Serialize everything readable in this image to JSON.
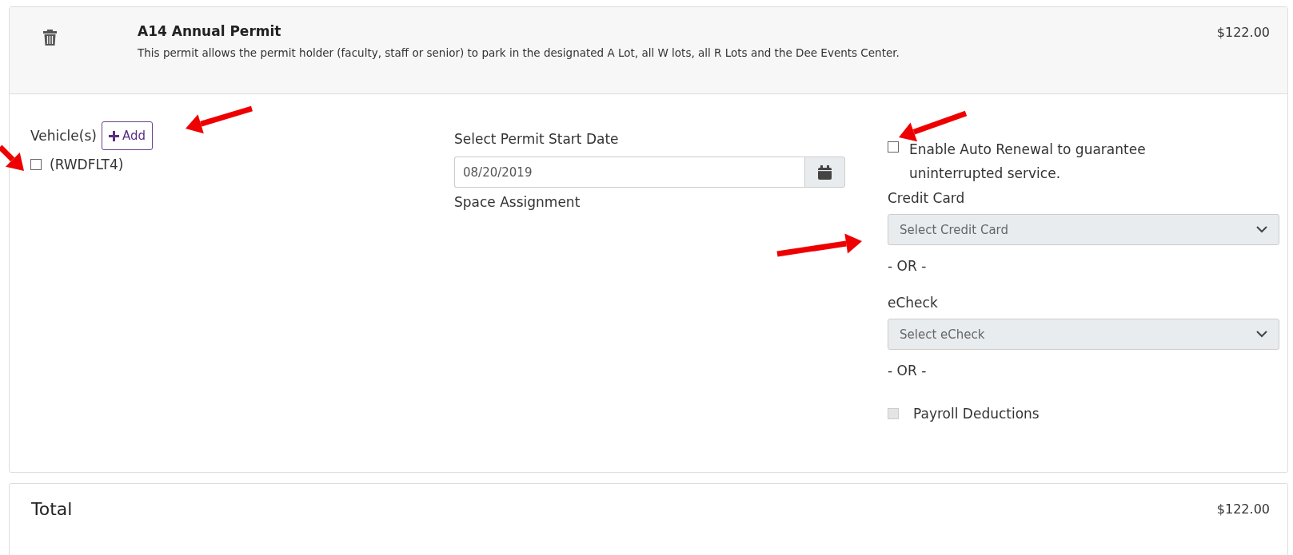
{
  "permit": {
    "title": "A14 Annual Permit",
    "description": "This permit allows the permit holder (faculty, staff or senior) to park in the designated A Lot, all W lots, all R Lots and the Dee Events Center.",
    "price": "$122.00"
  },
  "vehicles": {
    "label": "Vehicle(s)",
    "add_button": "Add",
    "items": [
      {
        "label": "(RWDFLT4)",
        "checked": false
      }
    ]
  },
  "start_date": {
    "label": "Select Permit Start Date",
    "value": "08/20/2019"
  },
  "space_assignment": {
    "label": "Space Assignment"
  },
  "auto_renewal": {
    "label": "Enable Auto Renewal to guarantee uninterrupted service.",
    "checked": false
  },
  "payment": [
    {
      "kind": "select",
      "label": "Credit Card",
      "placeholder": "Select Credit Card"
    },
    {
      "kind": "separator",
      "label": "- OR -"
    },
    {
      "kind": "select",
      "label": "eCheck",
      "placeholder": "Select eCheck"
    },
    {
      "kind": "separator",
      "label": "- OR -"
    },
    {
      "kind": "checkbox",
      "label": "Payroll Deductions",
      "checked": false,
      "disabled": true
    }
  ],
  "total": {
    "label": "Total",
    "amount": "$122.00"
  }
}
